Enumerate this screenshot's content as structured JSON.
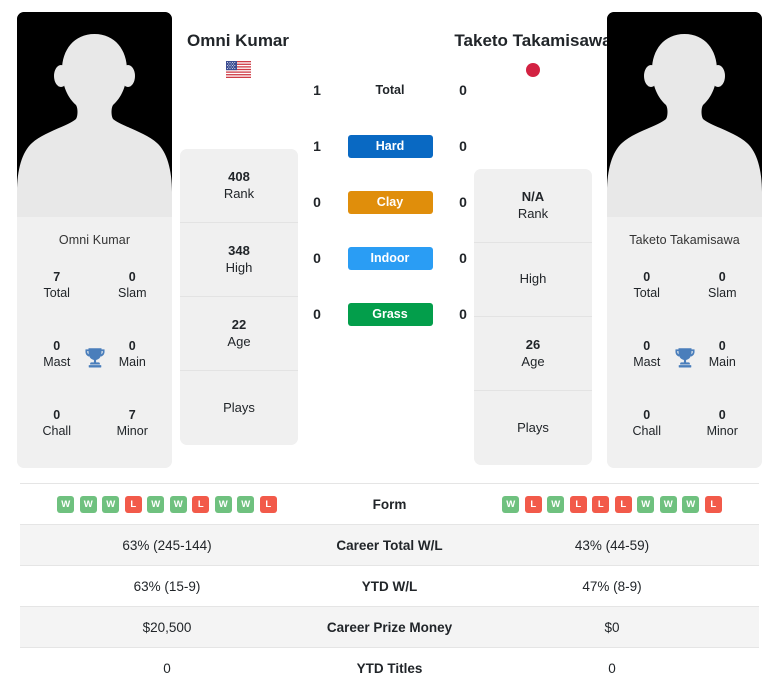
{
  "players": {
    "left": {
      "name": "Omni Kumar",
      "photo_caption": "Omni Kumar",
      "flag": "us-flag-icon",
      "flag_country": "United States",
      "titles": [
        {
          "value": "7",
          "label": "Total"
        },
        {
          "value": "0",
          "label": "Slam"
        },
        {
          "value": "0",
          "label": "Mast"
        },
        {
          "value": "0",
          "label": "Main"
        },
        {
          "value": "0",
          "label": "Chall"
        },
        {
          "value": "7",
          "label": "Minor"
        }
      ],
      "info": [
        {
          "value": "408",
          "label": "Rank"
        },
        {
          "value": "348",
          "label": "High"
        },
        {
          "value": "22",
          "label": "Age"
        },
        {
          "value": "",
          "label": "Plays"
        }
      ],
      "form": [
        "W",
        "W",
        "W",
        "L",
        "W",
        "W",
        "L",
        "W",
        "W",
        "L"
      ],
      "career_total_wl": "63% (245-144)",
      "ytd_wl": "63% (15-9)",
      "career_prize_money": "$20,500",
      "ytd_titles": "0"
    },
    "right": {
      "name": "Taketo Takamisawa",
      "photo_caption": "Taketo Takamisawa",
      "flag": "jp-flag-icon",
      "flag_country": "Japan",
      "titles": [
        {
          "value": "0",
          "label": "Total"
        },
        {
          "value": "0",
          "label": "Slam"
        },
        {
          "value": "0",
          "label": "Mast"
        },
        {
          "value": "0",
          "label": "Main"
        },
        {
          "value": "0",
          "label": "Chall"
        },
        {
          "value": "0",
          "label": "Minor"
        }
      ],
      "info": [
        {
          "value": "N/A",
          "label": "Rank"
        },
        {
          "value": "",
          "label": "High"
        },
        {
          "value": "26",
          "label": "Age"
        },
        {
          "value": "",
          "label": "Plays"
        }
      ],
      "form": [
        "W",
        "L",
        "W",
        "L",
        "L",
        "L",
        "W",
        "W",
        "W",
        "L"
      ],
      "career_total_wl": "43% (44-59)",
      "ytd_wl": "47% (8-9)",
      "career_prize_money": "$0",
      "ytd_titles": "0"
    }
  },
  "surfaces": [
    {
      "label": "Total",
      "left": "1",
      "right": "0",
      "color": "transparent",
      "text_color": "#212529"
    },
    {
      "label": "Hard",
      "left": "1",
      "right": "0",
      "color": "#0969c3",
      "text_color": "#ffffff"
    },
    {
      "label": "Clay",
      "left": "0",
      "right": "0",
      "color": "#e08e0b",
      "text_color": "#ffffff"
    },
    {
      "label": "Indoor",
      "left": "0",
      "right": "0",
      "color": "#2a9df4",
      "text_color": "#ffffff"
    },
    {
      "label": "Grass",
      "left": "0",
      "right": "0",
      "color": "#039e4b",
      "text_color": "#ffffff"
    }
  ],
  "table": {
    "rows": [
      {
        "label": "Form",
        "type": "form"
      },
      {
        "label": "Career Total W/L",
        "type": "text",
        "key": "career_total_wl"
      },
      {
        "label": "YTD W/L",
        "type": "text",
        "key": "ytd_wl"
      },
      {
        "label": "Career Prize Money",
        "type": "text",
        "key": "career_prize_money"
      },
      {
        "label": "YTD Titles",
        "type": "text",
        "key": "ytd_titles"
      }
    ]
  },
  "colors": {
    "win_badge": "#6fc17f",
    "loss_badge": "#f25a4a",
    "card_bg": "#f0f0f0",
    "row_alt_bg": "#f4f4f4",
    "trophy": "#4a7ebb"
  },
  "labels": {
    "form_row": "Form",
    "career_total_wl_row": "Career Total W/L",
    "ytd_wl_row": "YTD W/L",
    "career_prize_money_row": "Career Prize Money",
    "ytd_titles_row": "YTD Titles"
  }
}
